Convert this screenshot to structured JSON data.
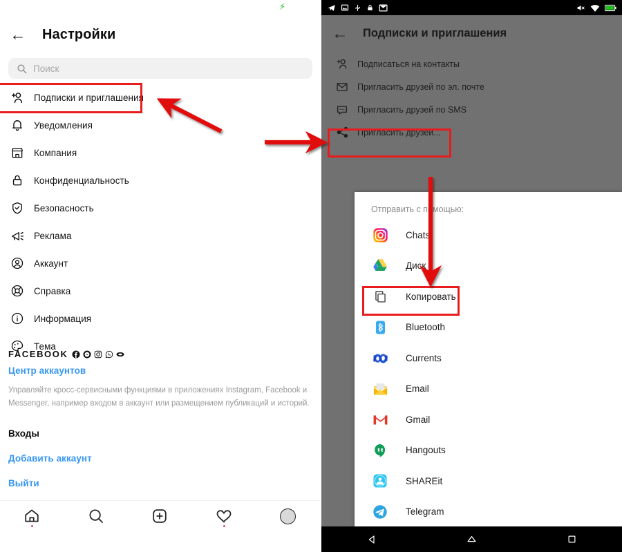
{
  "left_phone": {
    "status_bar": {
      "charging_icon": "charging-bolt-icon"
    },
    "header": {
      "back_icon": "back-arrow-icon",
      "title": "Настройки"
    },
    "search": {
      "icon": "search-icon",
      "placeholder": "Поиск",
      "value": ""
    },
    "menu_items": [
      {
        "icon": "person-add-icon",
        "label": "Подписки и приглашения",
        "highlighted": true
      },
      {
        "icon": "bell-icon",
        "label": "Уведомления"
      },
      {
        "icon": "store-icon",
        "label": "Компания"
      },
      {
        "icon": "lock-icon",
        "label": "Конфиденциальность"
      },
      {
        "icon": "shield-check-icon",
        "label": "Безопасность"
      },
      {
        "icon": "megaphone-icon",
        "label": "Реклама"
      },
      {
        "icon": "account-circle-icon",
        "label": "Аккаунт"
      },
      {
        "icon": "lifebuoy-icon",
        "label": "Справка"
      },
      {
        "icon": "info-icon",
        "label": "Информация"
      },
      {
        "icon": "palette-icon",
        "label": "Тема"
      }
    ],
    "facebook_section": {
      "title": "FACEBOOK",
      "family_icons": [
        "facebook-icon",
        "messenger-icon",
        "instagram-icon",
        "whatsapp-icon",
        "oculus-icon"
      ],
      "accounts_center_link": "Центр аккаунтов",
      "description": "Управляйте кросс-сервисными функциями в приложениях Instagram, Facebook и Messenger, например входом в аккаунт или размещением публикаций и историй.",
      "logins_heading": "Входы",
      "add_account_link": "Добавить аккаунт",
      "logout_link": "Выйти"
    },
    "bottom_nav": [
      {
        "icon": "home-icon",
        "badge": true
      },
      {
        "icon": "search-icon",
        "badge": false
      },
      {
        "icon": "add-post-icon",
        "badge": false
      },
      {
        "icon": "heart-icon",
        "badge": true
      },
      {
        "icon": "profile-avatar-icon",
        "badge": false
      }
    ]
  },
  "right_phone": {
    "status_bar": {
      "left_icons": [
        "telegram-icon",
        "image-icon",
        "usb-icon",
        "lock-icon",
        "mail-icon"
      ],
      "right_icons": [
        "mute-icon",
        "wifi-icon",
        "battery-icon"
      ]
    },
    "header": {
      "back_icon": "back-arrow-icon",
      "title": "Подписки и приглашения"
    },
    "menu_items": [
      {
        "icon": "person-add-icon",
        "label": "Подписаться на контакты"
      },
      {
        "icon": "envelope-icon",
        "label": "Пригласить друзей по эл. почте"
      },
      {
        "icon": "sms-bubble-icon",
        "label": "Пригласить друзей по SMS"
      },
      {
        "icon": "share-nodes-icon",
        "label": "Пригласить друзей...",
        "highlighted": true
      }
    ],
    "share_sheet": {
      "title": "Отправить с помощью:",
      "targets": [
        {
          "icon": "instagram-icon",
          "label": "Chats"
        },
        {
          "icon": "google-drive-icon",
          "label": "Диск"
        },
        {
          "icon": "copy-icon",
          "label": "Копировать",
          "highlighted": true
        },
        {
          "icon": "bluetooth-icon",
          "label": "Bluetooth"
        },
        {
          "icon": "currents-icon",
          "label": "Currents"
        },
        {
          "icon": "email-icon",
          "label": "Email"
        },
        {
          "icon": "gmail-icon",
          "label": "Gmail"
        },
        {
          "icon": "hangouts-icon",
          "label": "Hangouts"
        },
        {
          "icon": "shareit-icon",
          "label": "SHAREit"
        },
        {
          "icon": "telegram-icon",
          "label": "Telegram"
        }
      ]
    },
    "system_nav": [
      {
        "icon": "android-back-icon"
      },
      {
        "icon": "android-home-icon"
      },
      {
        "icon": "android-recents-icon"
      }
    ]
  },
  "annotations": {
    "highlight_color": "#e81c1c",
    "arrows": [
      {
        "name": "arrow-to-subscriptions",
        "direction": "up-left"
      },
      {
        "name": "arrow-to-invite-friends",
        "direction": "right"
      },
      {
        "name": "arrow-to-copy",
        "direction": "down"
      }
    ]
  }
}
